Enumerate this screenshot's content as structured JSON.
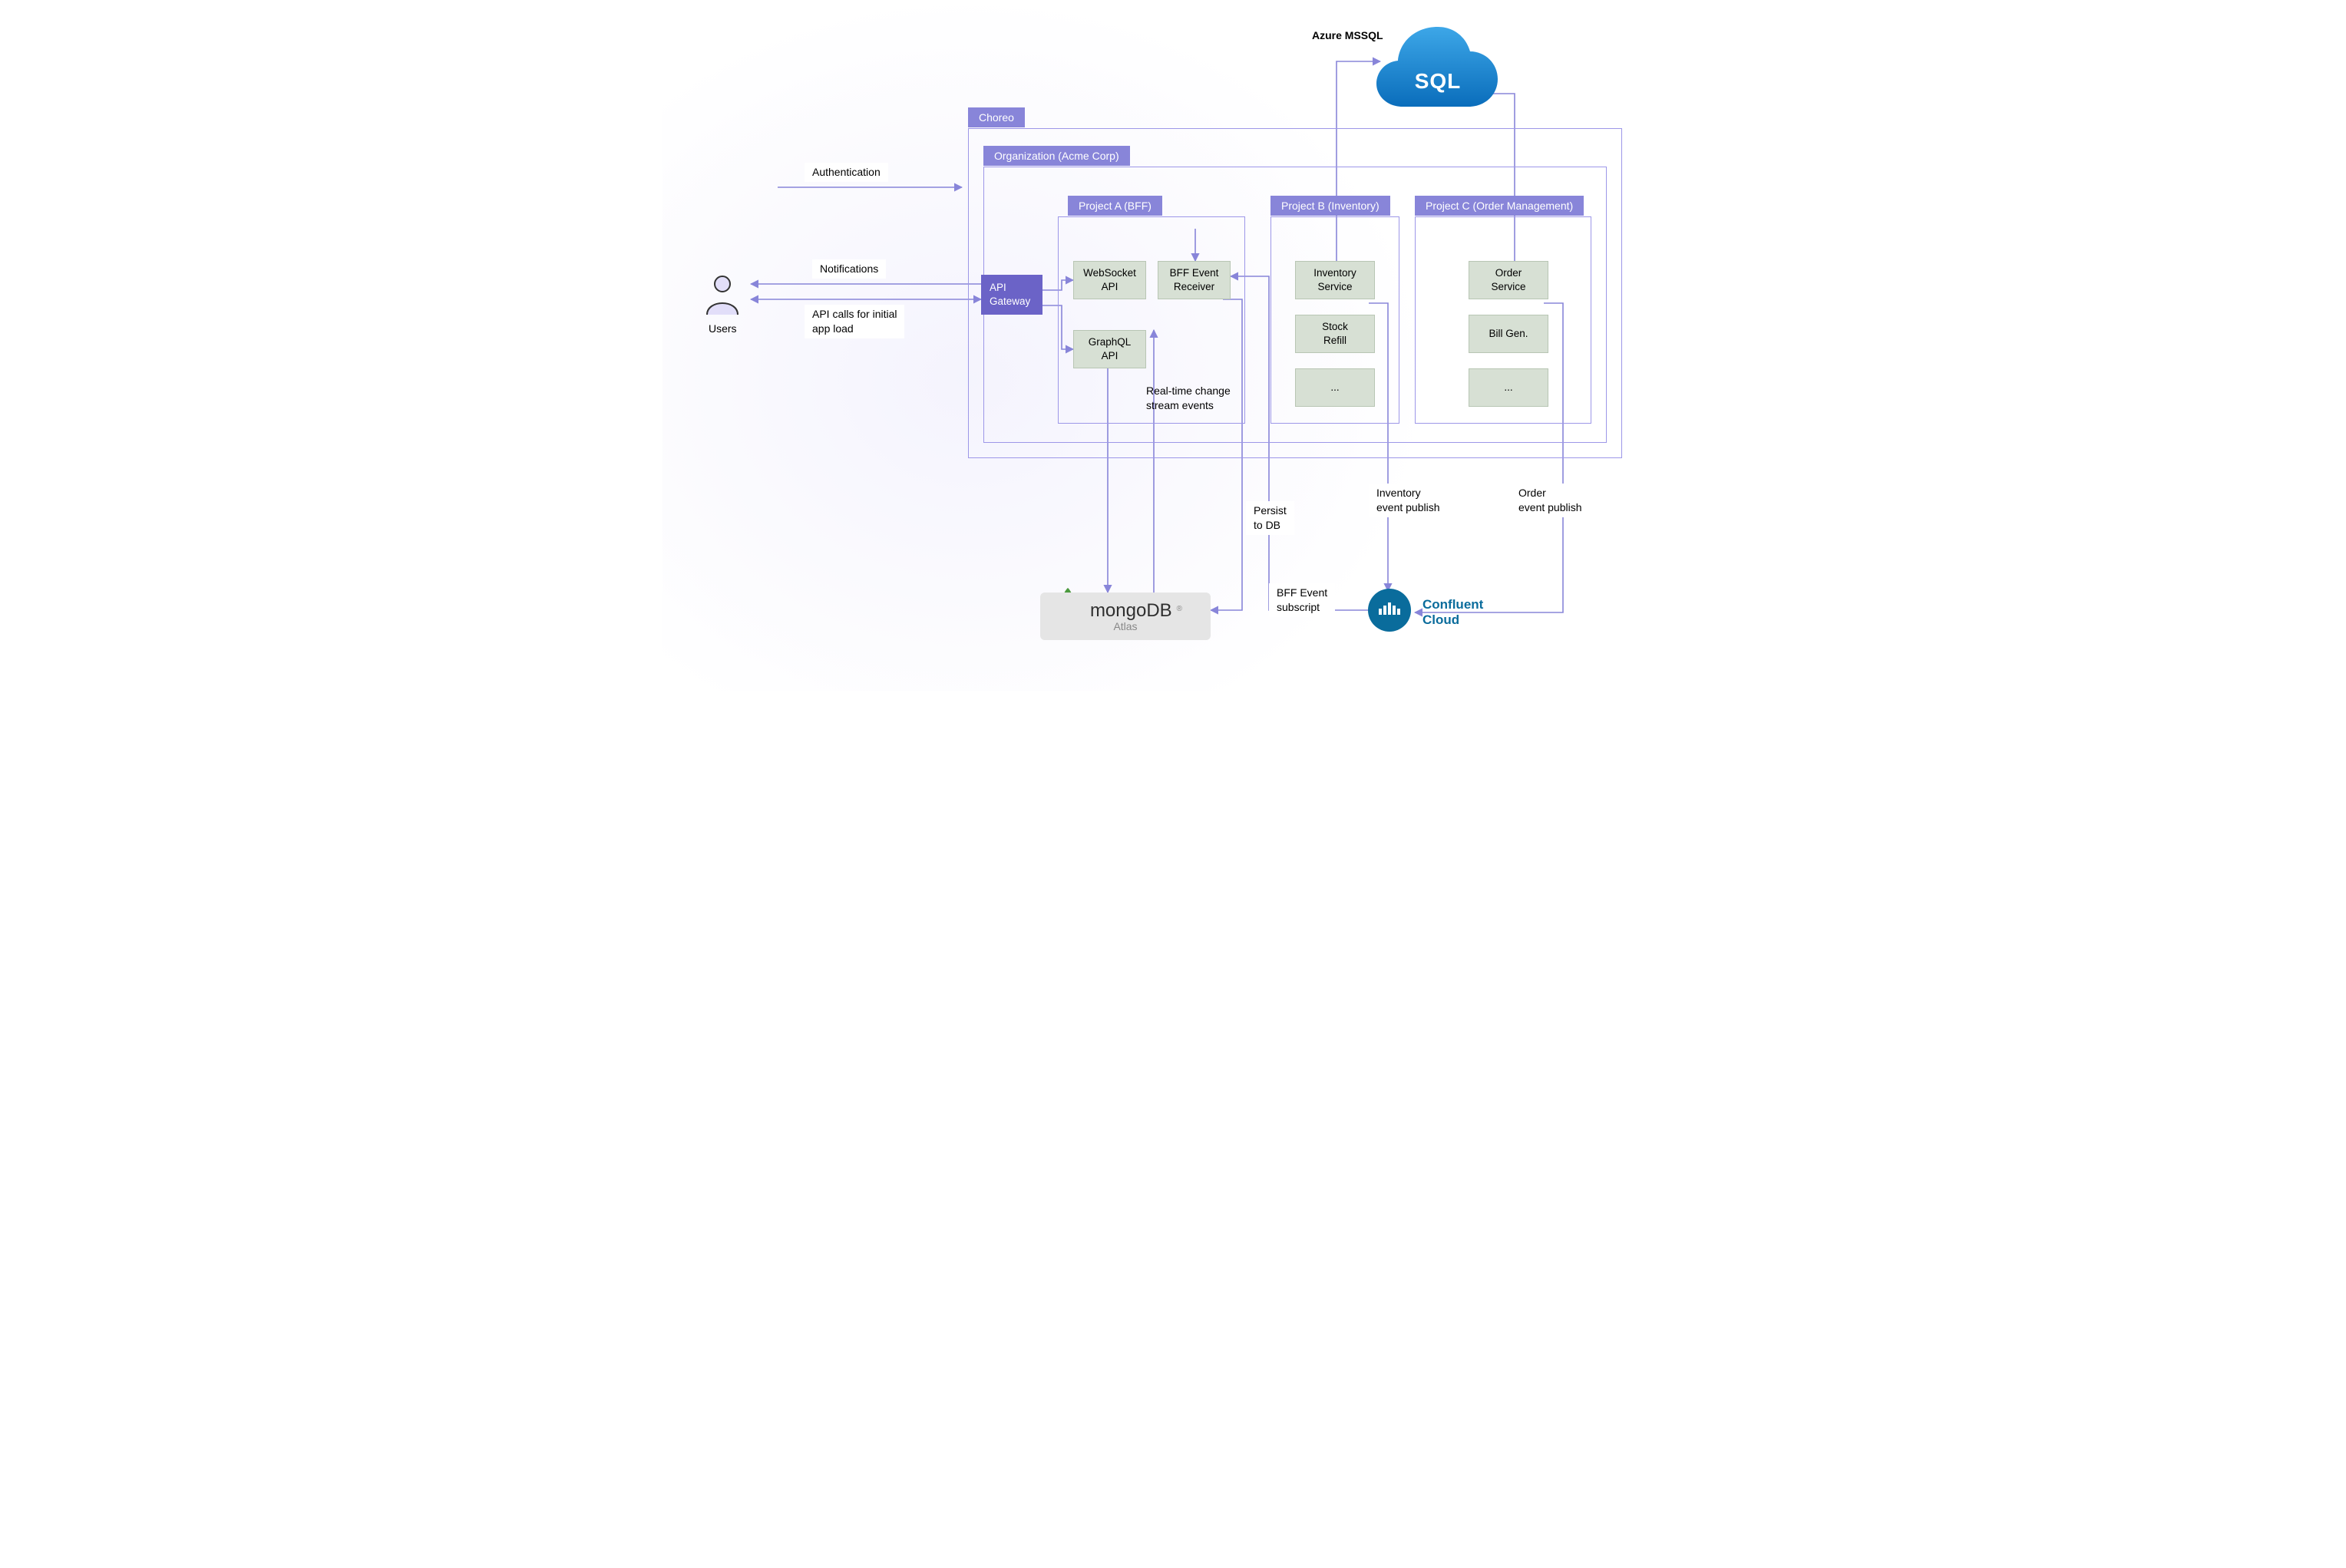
{
  "choreo": {
    "tab": "Choreo"
  },
  "org": {
    "tab": "Organization (Acme Corp)"
  },
  "projectA": {
    "tab": "Project A (BFF)",
    "gateway": "API\nGateway",
    "websocket": "WebSocket\nAPI",
    "bff_receiver": "BFF Event\nReceiver",
    "graphql": "GraphQL\nAPI"
  },
  "projectB": {
    "tab": "Project B (Inventory)",
    "inventory": "Inventory\nService",
    "stock": "Stock\nRefill",
    "more": "..."
  },
  "projectC": {
    "tab": "Project C (Order Management)",
    "order": "Order\nService",
    "bill": "Bill Gen.",
    "more": "..."
  },
  "labels": {
    "authentication": "Authentication",
    "notifications": "Notifications",
    "api_calls": "API calls for initial\napp load",
    "realtime": "Real-time change\nstream events",
    "persist": "Persist\nto DB",
    "bff_sub": "BFF Event\nsubscript",
    "inventory_pub": "Inventory\nevent publish",
    "order_pub": "Order\nevent publish",
    "users": "Users",
    "azure": "Azure MSSQL",
    "sql": "SQL",
    "mongo": "mongoDB",
    "mongo_sub": "Atlas",
    "confluent": "Confluent\nCloud"
  }
}
